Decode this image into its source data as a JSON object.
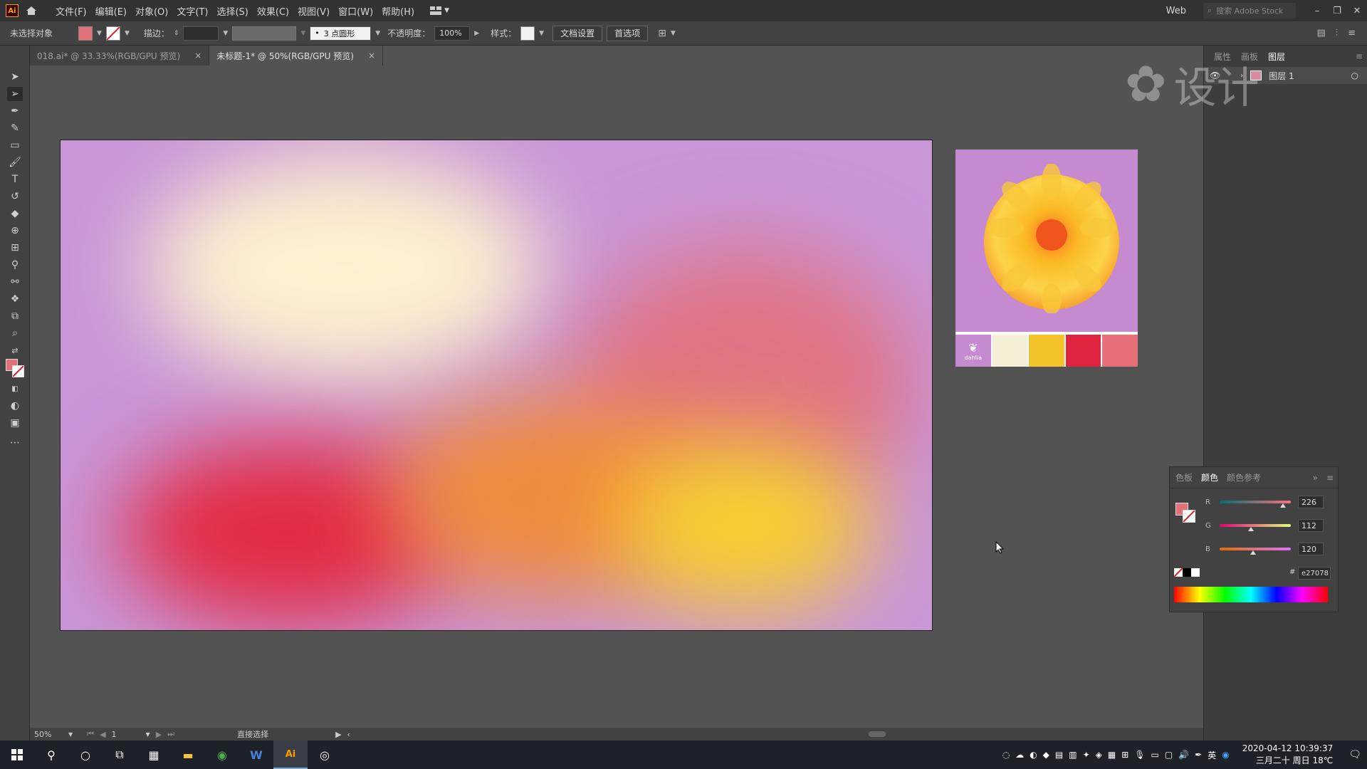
{
  "app": {
    "logo_text": "Ai",
    "menus": [
      "文件(F)",
      "编辑(E)",
      "对象(O)",
      "文字(T)",
      "选择(S)",
      "效果(C)",
      "视图(V)",
      "窗口(W)",
      "帮助(H)"
    ],
    "workspace": "Web",
    "search_placeholder": "搜索 Adobe Stock"
  },
  "controlbar": {
    "selection_label": "未选择对象",
    "fill_color": "#e27078",
    "stroke_label": "描边：",
    "brush_label": "3 点圆形",
    "opacity_label": "不透明度：",
    "opacity_value": "100%",
    "style_label": "样式：",
    "doc_setup_button": "文档设置",
    "prefs_button": "首选项"
  },
  "tabs": [
    {
      "label": "018.ai* @ 33.33%(RGB/GPU 预览)",
      "close": "×"
    },
    {
      "label": "未标题-1* @ 50%(RGB/GPU 预览)",
      "close": "×"
    }
  ],
  "dock": {
    "tabs": [
      "属性",
      "画板",
      "图层"
    ],
    "layer_name": "图层 1"
  },
  "color_panel": {
    "tabs": [
      "色板",
      "颜色",
      "颜色参考"
    ],
    "channels": [
      {
        "name": "R",
        "value": "226",
        "fraction": 0.886,
        "gradient": "linear-gradient(to right, #007078, #ff7078)"
      },
      {
        "name": "G",
        "value": "112",
        "fraction": 0.439,
        "gradient": "linear-gradient(to right, #e20078, #e2ff78)"
      },
      {
        "name": "B",
        "value": "120",
        "fraction": 0.471,
        "gradient": "linear-gradient(to right, #e27000, #e270ff)"
      }
    ],
    "hex_label": "#",
    "hex_value": "e27078"
  },
  "reference_palette": [
    "#f6efd8",
    "#f4c22a",
    "#e0233f",
    "#e5707a"
  ],
  "reference_text": "dahlia",
  "statusbar": {
    "zoom": "50%",
    "artboard_index": "1",
    "tool_name": "直接选择"
  },
  "taskbar": {
    "ime": "英",
    "date": "2020-04-12",
    "time": "10:39:37",
    "day_info": "三月二十 周日 18℃"
  },
  "watermark": "设计"
}
